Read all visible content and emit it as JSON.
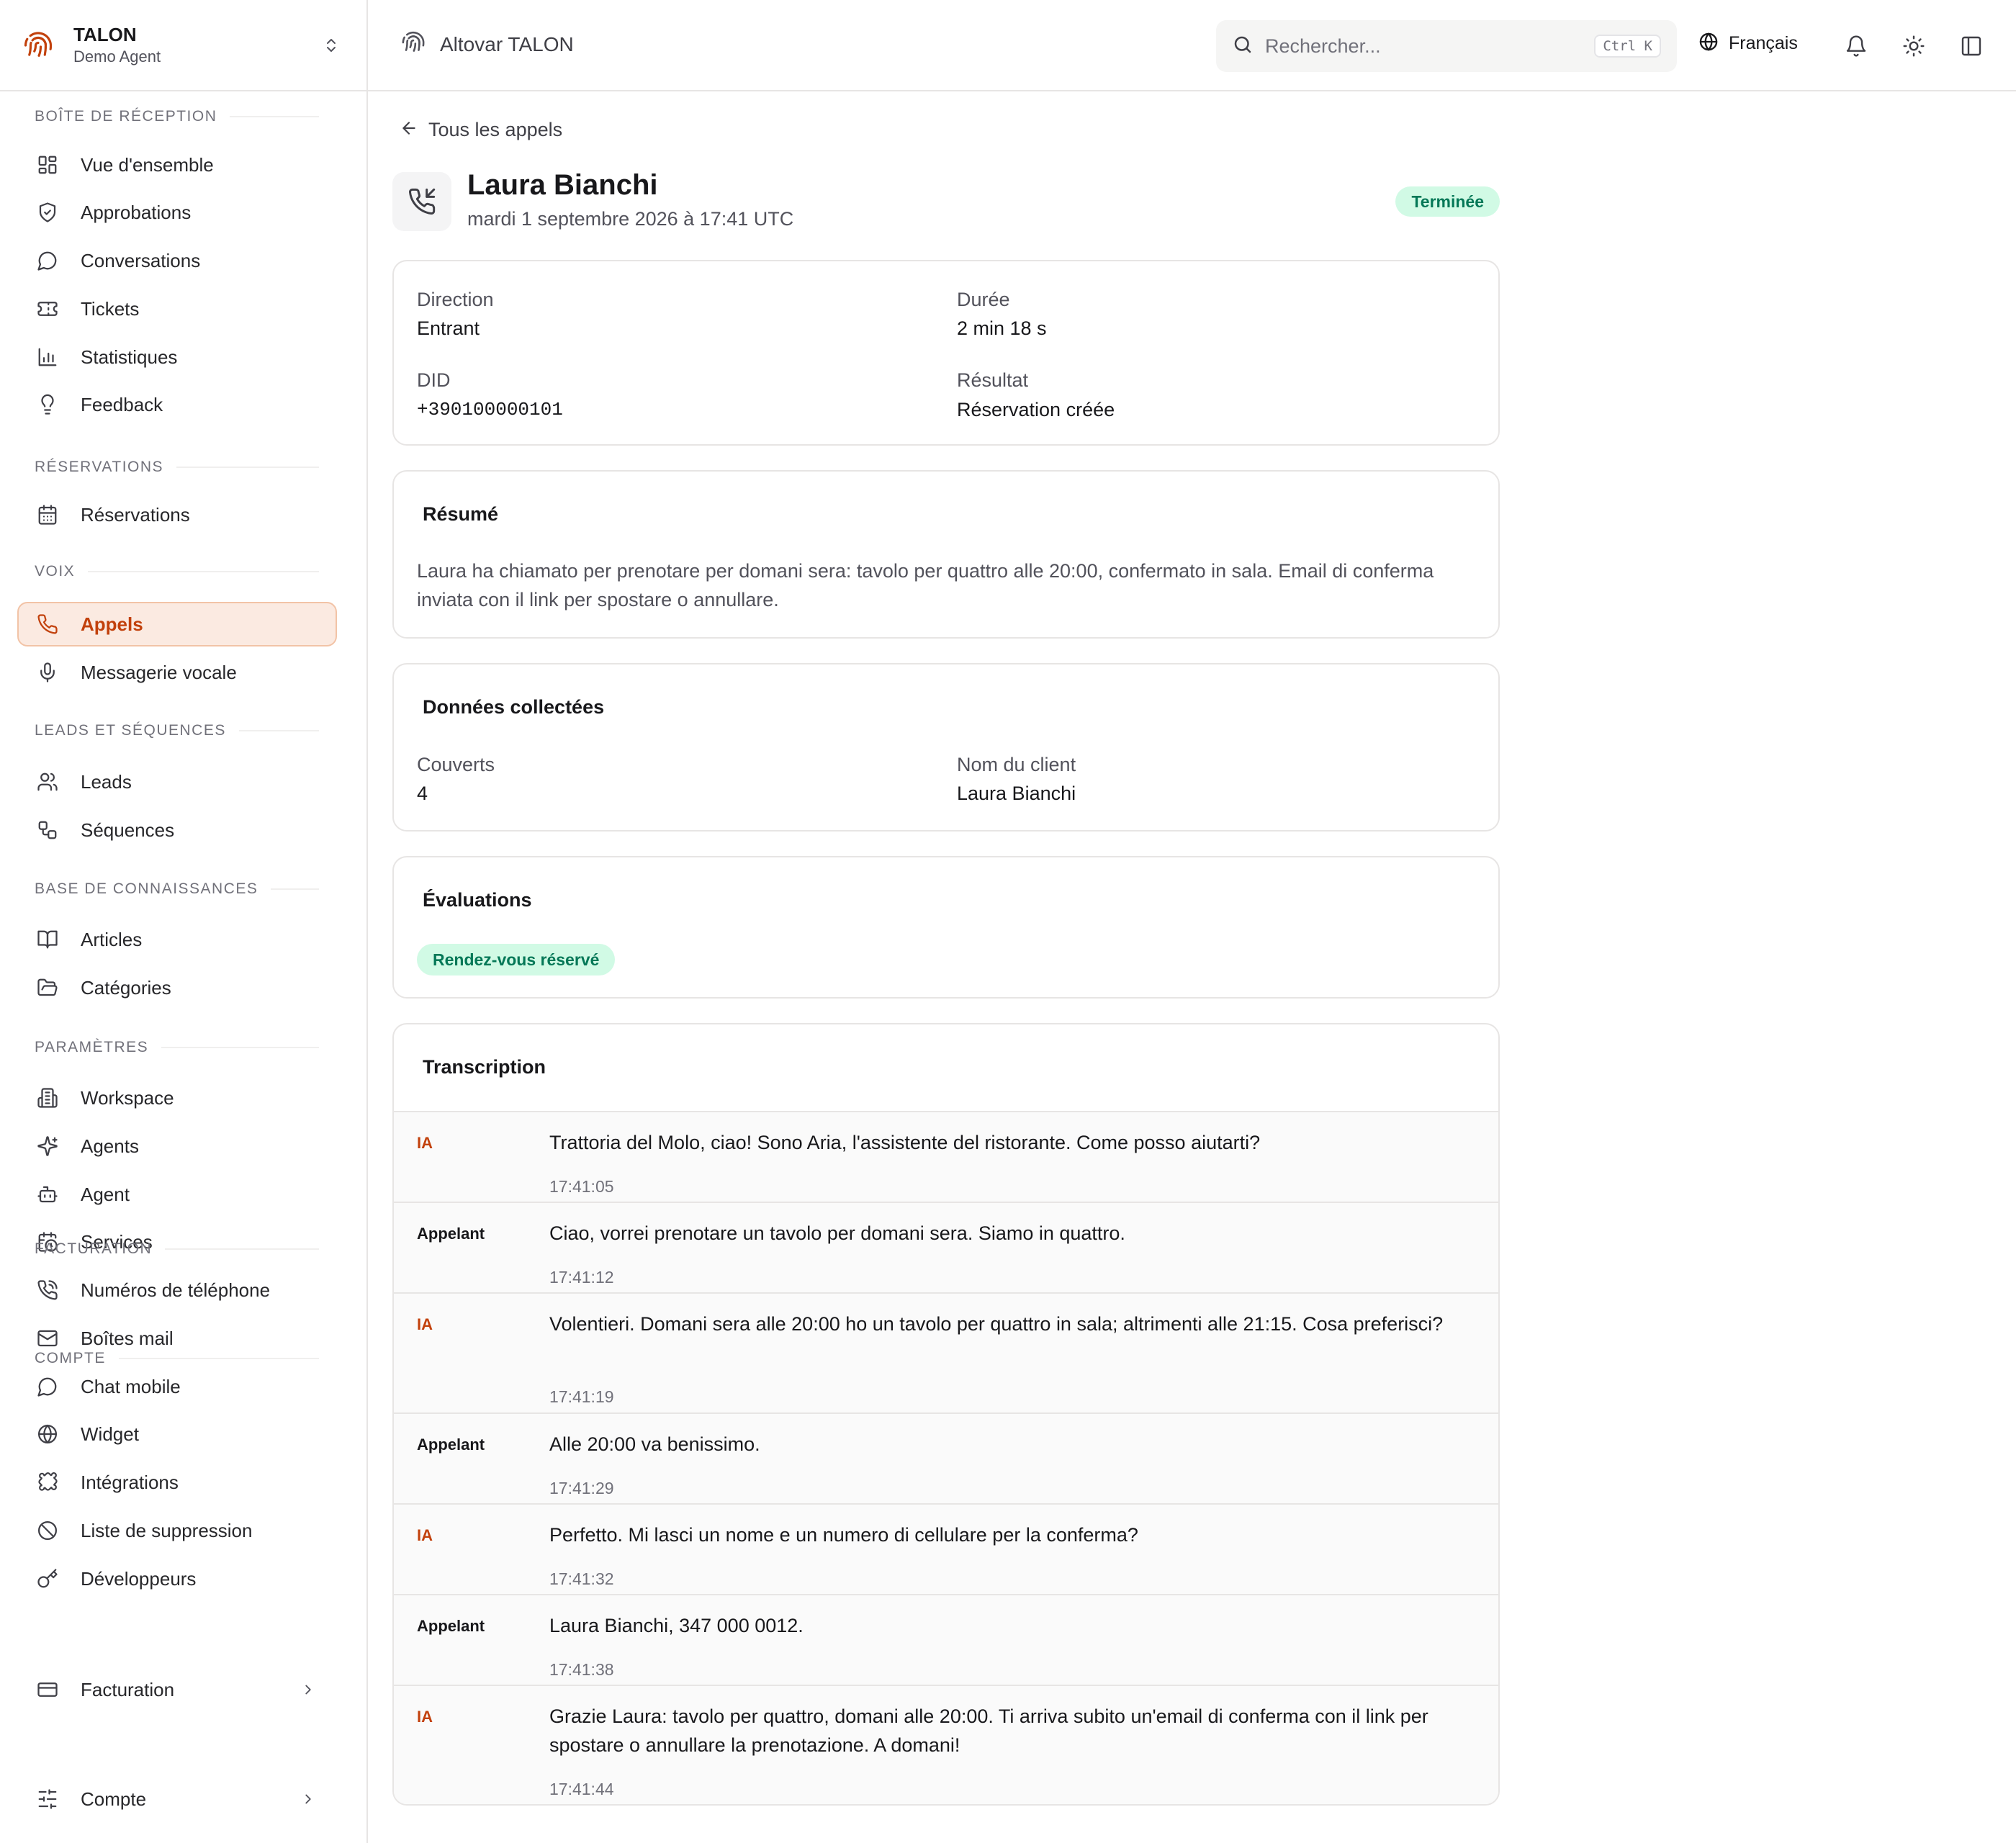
{
  "brand": {
    "name": "TALON",
    "subtitle": "Demo Agent"
  },
  "sidebar": {
    "sections": [
      {
        "label": "BOÎTE DE RÉCEPTION",
        "items": [
          {
            "label": "Vue d'ensemble",
            "icon": "dashboard-icon"
          },
          {
            "label": "Approbations",
            "icon": "shield-check-icon"
          },
          {
            "label": "Conversations",
            "icon": "chat-bubble-icon"
          },
          {
            "label": "Tickets",
            "icon": "ticket-icon"
          },
          {
            "label": "Statistiques",
            "icon": "bar-chart-icon"
          },
          {
            "label": "Feedback",
            "icon": "lightbulb-icon"
          }
        ]
      },
      {
        "label": "RÉSERVATIONS",
        "items": [
          {
            "label": "Réservations",
            "icon": "calendar-icon"
          }
        ]
      },
      {
        "label": "VOIX",
        "items": [
          {
            "label": "Appels",
            "icon": "phone-icon",
            "active": true
          },
          {
            "label": "Messagerie vocale",
            "icon": "microphone-icon"
          }
        ]
      },
      {
        "label": "LEADS ET SÉQUENCES",
        "items": [
          {
            "label": "Leads",
            "icon": "users-icon"
          },
          {
            "label": "Séquences",
            "icon": "workflow-icon"
          }
        ]
      },
      {
        "label": "BASE DE CONNAISSANCES",
        "items": [
          {
            "label": "Articles",
            "icon": "book-icon"
          },
          {
            "label": "Catégories",
            "icon": "folder-icon"
          }
        ]
      },
      {
        "label": "PARAMÈTRES",
        "items": [
          {
            "label": "Workspace",
            "icon": "building-icon"
          },
          {
            "label": "Agents",
            "icon": "sparkles-icon"
          },
          {
            "label": "Agent",
            "icon": "robot-icon"
          },
          {
            "label": "Services",
            "icon": "calendar-clock-icon"
          },
          {
            "label": "Numéros de téléphone",
            "icon": "phone-call-icon"
          },
          {
            "label": "Boîtes mail",
            "icon": "mail-icon"
          },
          {
            "label": "Chat mobile",
            "icon": "chat-bubble-icon"
          },
          {
            "label": "Widget",
            "icon": "globe-icon"
          },
          {
            "label": "Intégrations",
            "icon": "puzzle-icon"
          },
          {
            "label": "Liste de suppression",
            "icon": "ban-icon"
          },
          {
            "label": "Développeurs",
            "icon": "key-icon"
          }
        ]
      },
      {
        "label": "FACTURATION",
        "items": [
          {
            "label": "Facturation",
            "icon": "credit-card-icon",
            "chevron": true
          }
        ]
      },
      {
        "label": "COMPTE",
        "items": [
          {
            "label": "Compte",
            "icon": "sliders-icon",
            "chevron": true
          }
        ]
      }
    ]
  },
  "topbar": {
    "org_name": "Altovar TALON",
    "search_placeholder": "Rechercher...",
    "search_shortcut": "Ctrl K",
    "language": "Français"
  },
  "call": {
    "back_label": "Tous les appels",
    "caller_name": "Laura Bianchi",
    "date": "mardi 1 septembre 2026 à 17:41 UTC",
    "status": "Terminée",
    "details": {
      "direction_label": "Direction",
      "direction_value": "Entrant",
      "duration_label": "Durée",
      "duration_value": "2 min 18 s",
      "did_label": "DID",
      "did_value": "+390100000101",
      "result_label": "Résultat",
      "result_value": "Réservation créée"
    },
    "summary_title": "Résumé",
    "summary_text": "Laura ha chiamato per prenotare per domani sera: tavolo per quattro alle 20:00, confermato in sala. Email di conferma inviata con il link per spostare o annullare.",
    "collected_title": "Données collectées",
    "collected": {
      "covers_label": "Couverts",
      "covers_value": "4",
      "client_label": "Nom du client",
      "client_value": "Laura Bianchi"
    },
    "evaluations_title": "Évaluations",
    "evaluation_badge": "Rendez-vous réservé",
    "transcript_title": "Transcription",
    "transcript": [
      {
        "speaker": "IA",
        "text": "Trattoria del Molo, ciao! Sono Aria, l'assistente del ristorante. Come posso aiutarti?",
        "time": "17:41:05"
      },
      {
        "speaker": "Appelant",
        "text": "Ciao, vorrei prenotare un tavolo per domani sera. Siamo in quattro.",
        "time": "17:41:12"
      },
      {
        "speaker": "IA",
        "text": "Volentieri. Domani sera alle 20:00 ho un tavolo per quattro in sala; altrimenti alle 21:15. Cosa preferisci?",
        "time": "17:41:19"
      },
      {
        "speaker": "Appelant",
        "text": "Alle 20:00 va benissimo.",
        "time": "17:41:29"
      },
      {
        "speaker": "IA",
        "text": "Perfetto. Mi lasci un nome e un numero di cellulare per la conferma?",
        "time": "17:41:32"
      },
      {
        "speaker": "Appelant",
        "text": "Laura Bianchi, 347 000 0012.",
        "time": "17:41:38"
      },
      {
        "speaker": "IA",
        "text": "Grazie Laura: tavolo per quattro, domani alle 20:00. Ti arriva subito un'email di conferma con il link per spostare o annullare la prenotazione. A domani!",
        "time": "17:41:44"
      }
    ]
  },
  "colors": {
    "accent": "#c2410c",
    "accent_bg": "#fbeae1",
    "success_bg": "#d1fae5",
    "success_text": "#047857"
  }
}
